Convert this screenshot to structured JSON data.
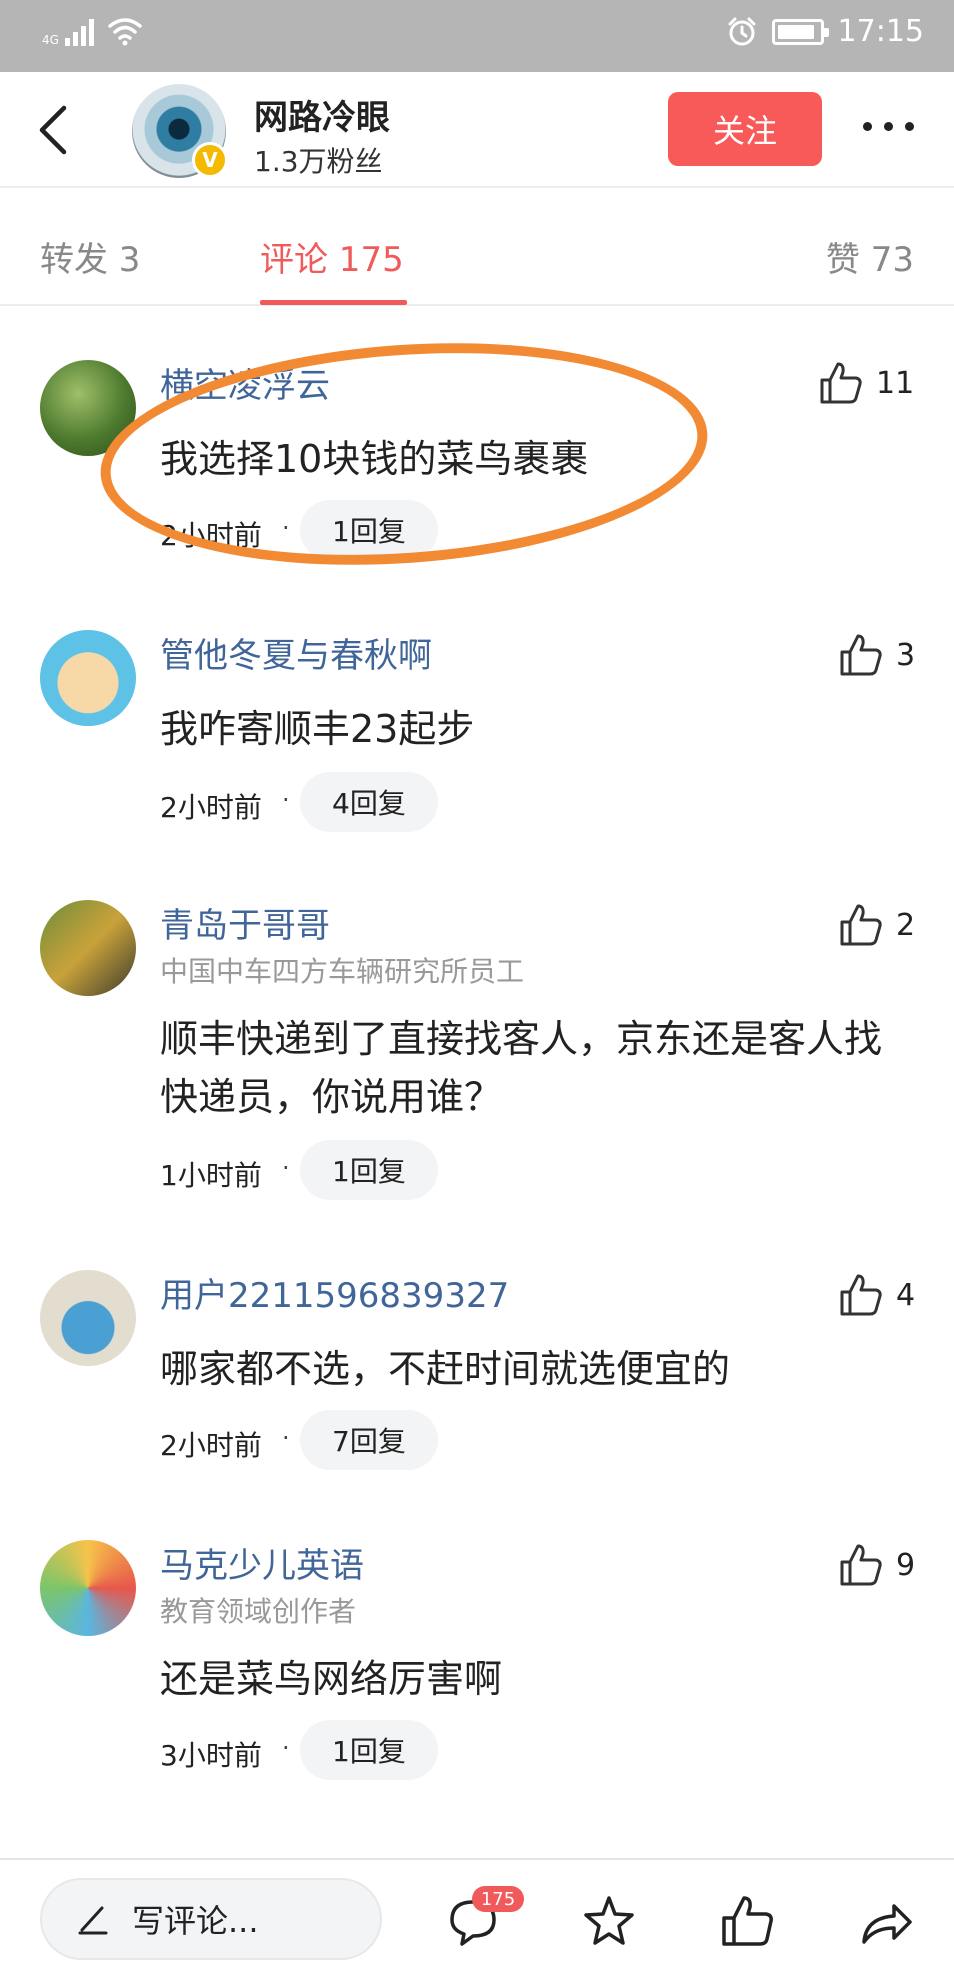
{
  "status_bar": {
    "network": "4G",
    "time": "17:15",
    "battery_level": 0.9
  },
  "header": {
    "author_name": "网路冷眼",
    "fans": "1.3万粉丝",
    "verified_badge": "V",
    "follow_label": "关注",
    "icons": [
      "back-arrow-icon",
      "more-dots-icon"
    ]
  },
  "tabs": {
    "forward": "转发 3",
    "comments": "评论 175",
    "likes": "赞 73",
    "active": "comments"
  },
  "comments": [
    {
      "name": "横空凌浮云",
      "subtitle": "",
      "text": "我选择10块钱的菜鸟裹裹",
      "time": "2小时前",
      "replies": "1回复",
      "likes": "11",
      "highlighted": true
    },
    {
      "name": "管他冬夏与春秋啊",
      "subtitle": "",
      "text": "我咋寄顺丰23起步",
      "time": "2小时前",
      "replies": "4回复",
      "likes": "3"
    },
    {
      "name": "青岛于哥哥",
      "subtitle": "中国中车四方车辆研究所员工",
      "text": "顺丰快递到了直接找客人，京东还是客人找快递员，你说用谁？",
      "time": "1小时前",
      "replies": "1回复",
      "likes": "2"
    },
    {
      "name": "用户2211596839327",
      "subtitle": "",
      "text": "哪家都不选，不赶时间就选便宜的",
      "time": "2小时前",
      "replies": "7回复",
      "likes": "4"
    },
    {
      "name": "马克少儿英语",
      "subtitle": "教育领域创作者",
      "text": "还是菜鸟网络厉害啊",
      "time": "3小时前",
      "replies": "1回复",
      "likes": "9"
    }
  ],
  "separator": "·",
  "bottom_bar": {
    "write_label": "写评论...",
    "comment_count_badge": "175",
    "icons": [
      "pencil-icon",
      "comment-icon",
      "star-icon",
      "thumbs-up-icon",
      "share-icon"
    ]
  },
  "colors": {
    "accent": "#f05a5a",
    "name_link": "#406599",
    "highlight_circle": "#f28a34"
  }
}
